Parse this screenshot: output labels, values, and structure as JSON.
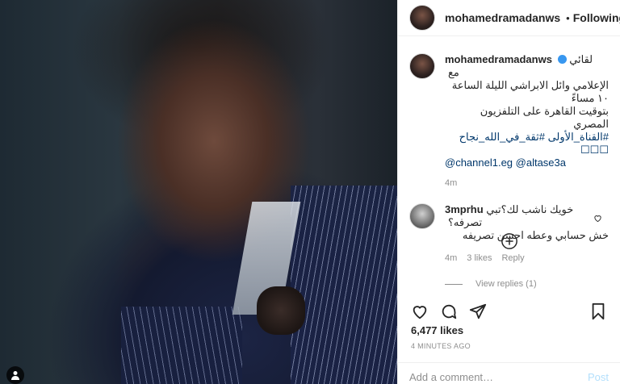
{
  "post": {
    "username": "mohamedramadanws",
    "follow_label": "Following",
    "separator": "•",
    "more_label": "•••"
  },
  "caption": {
    "username": "mohamedramadanws",
    "lines": [
      "لقائي مع",
      "الإعلامي وائل الابراشي الليلة الساعة ١٠ مساءً",
      "بتوقيت القاهرة على التلفزيون المصري",
      "#القناة_الأولى #ثقة_في_الله_نجاح ☐☐☐"
    ],
    "mentions": "@channel1.eg @altase3a",
    "age": "4m"
  },
  "comment": {
    "username": "3mprhu",
    "lines": [
      "خويك ناشب لك؟تبي تصرفه؟",
      "خش حسابي وعطه احسن تصريفه"
    ],
    "age": "4m",
    "likes": "3 likes",
    "reply_label": "Reply",
    "view_replies": "View replies (1)"
  },
  "stats": {
    "likes": "6,477 likes",
    "time": "4 MINUTES AGO"
  },
  "composer": {
    "placeholder": "Add a comment…",
    "post_label": "Post"
  },
  "colors": {
    "verified": "#3897f0",
    "link": "#00376b",
    "muted": "#8e8e8e",
    "post_disabled": "#b2dffc"
  },
  "icons": {
    "like": "heart-icon",
    "comment": "comment-icon",
    "share": "share-icon",
    "save": "bookmark-icon",
    "load_more": "plus-circle-icon",
    "user": "user-icon"
  }
}
